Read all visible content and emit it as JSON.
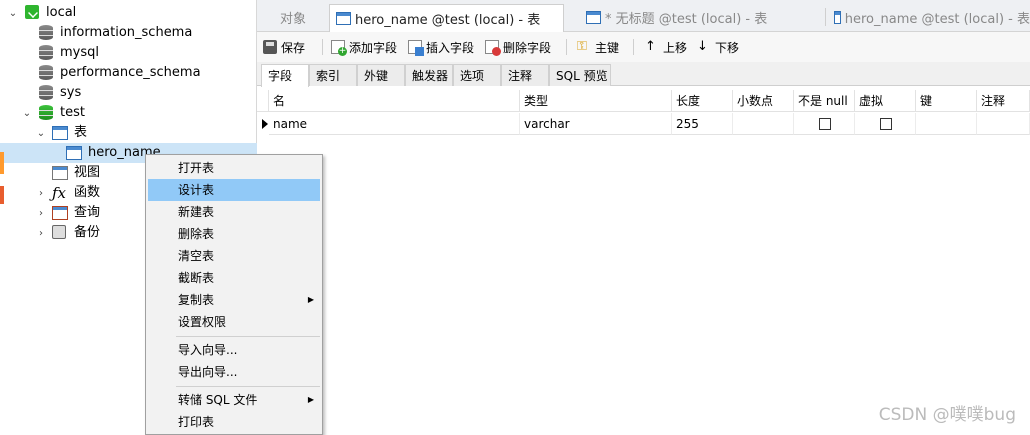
{
  "sidebar": {
    "connection": "local",
    "databases": [
      "information_schema",
      "mysql",
      "performance_schema",
      "sys",
      "test"
    ],
    "test_children": {
      "tables_label": "表",
      "table_item": "hero_name",
      "views_label": "视图",
      "functions_label": "函数",
      "queries_label": "查询",
      "backups_label": "备份"
    }
  },
  "tabs": [
    {
      "label": "对象"
    },
    {
      "label": "hero_name @test (local) - 表"
    },
    {
      "label": "* 无标题 @test (local) - 表"
    },
    {
      "label": "hero_name @test (local) - 表"
    }
  ],
  "toolbar": {
    "save": "保存",
    "add_field": "添加字段",
    "insert_field": "插入字段",
    "delete_field": "删除字段",
    "primary_key": "主键",
    "move_up": "上移",
    "move_down": "下移"
  },
  "subtabs": [
    "字段",
    "索引",
    "外键",
    "触发器",
    "选项",
    "注释",
    "SQL 预览"
  ],
  "grid": {
    "columns": [
      "名",
      "类型",
      "长度",
      "小数点",
      "不是 null",
      "虚拟",
      "键",
      "注释"
    ],
    "rows": [
      {
        "name": "name",
        "type": "varchar",
        "length": "255",
        "decimals": "",
        "not_null": false,
        "virtual": false,
        "key": "",
        "comment": ""
      }
    ]
  },
  "context_menu": {
    "items": [
      "打开表",
      "设计表",
      "新建表",
      "删除表",
      "清空表",
      "截断表",
      "复制表",
      "设置权限",
      "导入向导...",
      "导出向导...",
      "转储 SQL 文件",
      "打印表"
    ],
    "highlighted": "设计表"
  },
  "watermark": "CSDN @噗噗bug"
}
